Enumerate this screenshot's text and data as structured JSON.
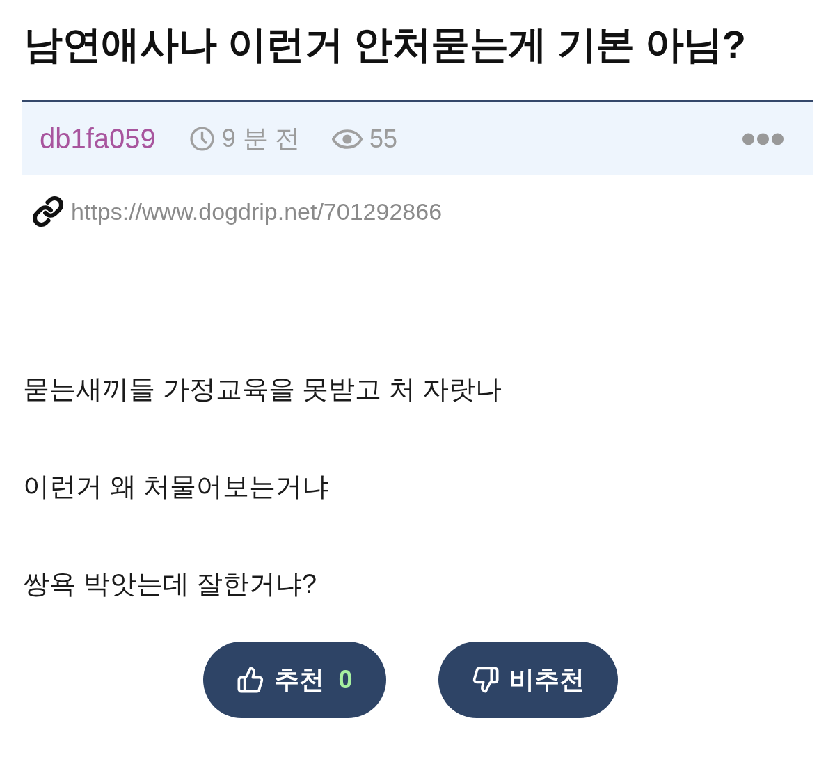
{
  "title": "남연애사나 이런거 안처묻는게 기본 아님?",
  "meta": {
    "author": "db1fa059",
    "time": "9 분 전",
    "views": "55"
  },
  "link": {
    "url": "https://www.dogdrip.net/701292866"
  },
  "body": [
    "묻는새끼들 가정교육을 못받고 처 자랏나",
    "이런거 왜 처물어보는거냐",
    "쌍욕 박앗는데 잘한거냐?"
  ],
  "votes": [
    {
      "kind": "up",
      "label": "추천",
      "count": "0"
    },
    {
      "kind": "down",
      "label": "비추천"
    }
  ]
}
